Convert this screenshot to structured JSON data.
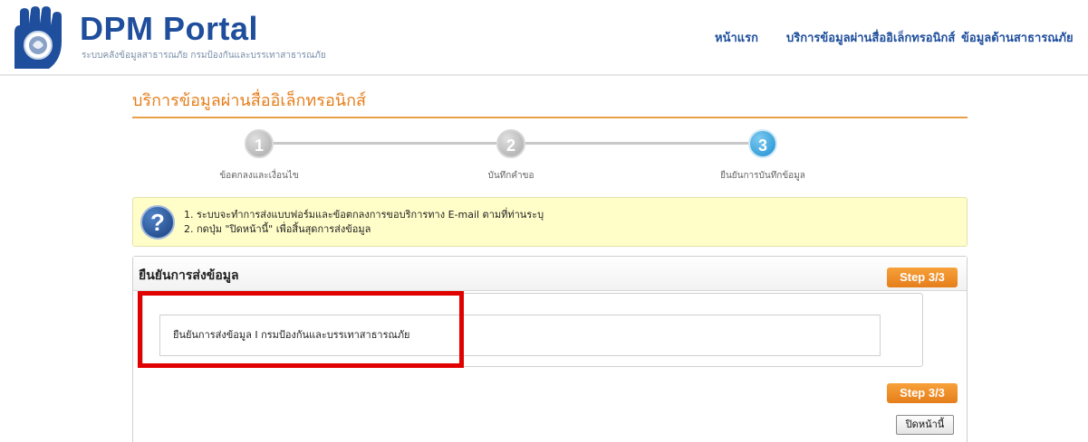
{
  "header": {
    "logo_title": "DPM Portal",
    "logo_subtitle": "ระบบคลังข้อมูลสาธารณภัย กรมป้องกันและบรรเทาสาธารณภัย",
    "nav": [
      {
        "label": "หน้าแรก"
      },
      {
        "label": "บริการข้อมูลผ่านสื่ออิเล็กทรอนิกส์"
      },
      {
        "label": "ข้อมูลด้านสาธารณภัย"
      }
    ]
  },
  "page_title": "บริการข้อมูลผ่านสื่ออิเล็กทรอนิกส์",
  "stepper": {
    "steps": [
      {
        "number": "1",
        "label": "ข้อตกลงและเงื่อนไข",
        "state": "inactive"
      },
      {
        "number": "2",
        "label": "บันทึกคำขอ",
        "state": "inactive"
      },
      {
        "number": "3",
        "label": "ยืนยันการบันทึกข้อมูล",
        "state": "active"
      }
    ]
  },
  "info": {
    "icon": "question-icon",
    "icon_glyph": "?",
    "lines": [
      "1. ระบบจะทำการส่งแบบฟอร์มและข้อตกลงการขอบริการทาง E-mail ตามที่ท่านระบุ",
      "2. กดปุ่ม \"ปิดหน้านี้\" เพื่อสิ้นสุดการส่งข้อมูล"
    ]
  },
  "panel": {
    "title": "ยืนยันการส่งข้อมูล",
    "step_badge": "Step 3/3",
    "confirm_text": "ยืนยันการส่งข้อมูล I กรมป้องกันและบรรเทาสาธารณภัย",
    "close_label": "ปิดหน้านี้"
  },
  "colors": {
    "brand_blue": "#1f4e9c",
    "accent_orange": "#e57e1b",
    "highlight_red": "#e00000",
    "info_bg": "#fffdc8"
  }
}
